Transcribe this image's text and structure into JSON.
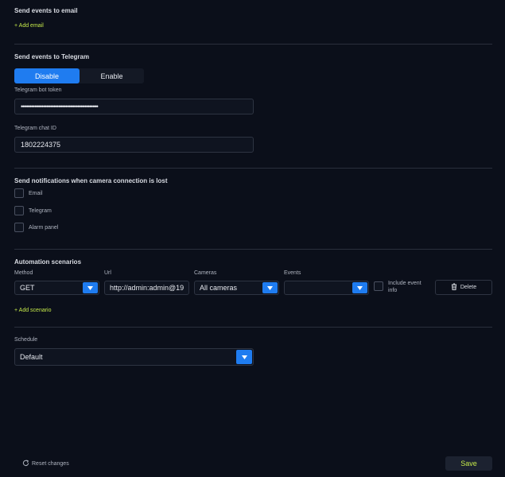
{
  "email": {
    "title": "Send events to email",
    "add_link": "+ Add email"
  },
  "telegram": {
    "title": "Send events to Telegram",
    "toggle": {
      "disable_label": "Disable",
      "enable_label": "Enable",
      "selected": "Disable"
    },
    "bot_token_label": "Telegram bot token",
    "bot_token_value": "•••••••••••••••••••••••••••••••••••••••••••••",
    "chat_id_label": "Telegram chat ID",
    "chat_id_value": "1802224375"
  },
  "notifications": {
    "title": "Send notifications when camera connection is lost",
    "options": [
      {
        "label": "Email",
        "checked": false
      },
      {
        "label": "Telegram",
        "checked": false
      },
      {
        "label": "Alarm panel",
        "checked": false
      }
    ]
  },
  "automation": {
    "title": "Automation scenarios",
    "method_label": "Method",
    "url_label": "Url",
    "cameras_label": "Cameras",
    "events_label": "Events",
    "method_value": "GET",
    "url_value": "http://admin:admin@19",
    "cameras_value": "All cameras",
    "events_value": "",
    "include_event_info_label": "Include event info",
    "delete_label": "Delete",
    "add_link": "+ Add scenario"
  },
  "schedule": {
    "label": "Schedule",
    "value": "Default"
  },
  "footer": {
    "reset_label": "Reset changes",
    "save_label": "Save"
  },
  "colors": {
    "background": "#0b0f1a",
    "accent_blue": "#1f7cf0",
    "lime": "#c5e94a"
  }
}
